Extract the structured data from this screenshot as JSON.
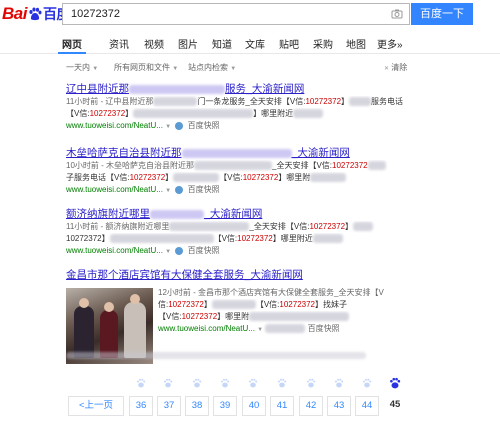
{
  "logo": {
    "part1": "Bai",
    "part2": "百度"
  },
  "search": {
    "value": "10272372",
    "button_label": "百度一下"
  },
  "tabs": [
    {
      "label": "网页"
    },
    {
      "label": "资讯"
    },
    {
      "label": "视频"
    },
    {
      "label": "图片"
    },
    {
      "label": "知道"
    },
    {
      "label": "文库"
    },
    {
      "label": "贴吧"
    },
    {
      "label": "采购"
    },
    {
      "label": "地图"
    },
    {
      "label": "更多»"
    }
  ],
  "filters": {
    "time": "一天内",
    "type": "所有网页和文件",
    "site": "站点内检索",
    "clear": "清除"
  },
  "results": [
    {
      "title_a": "辽中县附近那",
      "title_b": "服务_大渝新闻网",
      "line1_a": "11小时前 - 辽中县附近那",
      "line1_b": "门一条龙服务_全天安排【V信:",
      "line1_red": "10272372",
      "line1_c": "】",
      "line1_d": "服务电话",
      "line2_a": "【V信:",
      "line2_red": "10272372",
      "line2_b": "】",
      "line2_c": "】哪里附近",
      "line2_red2": "10272372",
      "line2_d": "】",
      "url": "www.tuoweisi.com/NeatU...",
      "snapshot": "百度快照"
    },
    {
      "title_a": "木垒哈萨克自治县附近那",
      "title_b": "_大渝新闻网",
      "line1_a": "10小时前 - 木垒哈萨克自治县附近那",
      "line1_b": "_全天安排【V信:",
      "line1_red": "10272372",
      "line1_c": "",
      "line1_d": "",
      "line2_a": "子服务电话【V信:",
      "line2_red": "10272372",
      "line2_b": "】",
      "line2_c": "【V信:",
      "line2_red2": "10272372",
      "line2_d": "】哪里附",
      "url": "www.tuoweisi.com/NeatU...",
      "snapshot": "百度快照"
    },
    {
      "title_a": "额济纳旗附近哪里",
      "title_b": "_大渝新闻网",
      "line1_a": "11小时前 - 额济纳旗附近哪里",
      "line1_b": "_全天安排【V信:",
      "line1_red": "10272372",
      "line1_c": "】",
      "line1_d": "",
      "line2_a": "10272372】",
      "line2_red": "",
      "line2_b": "",
      "line2_c": "【V信:",
      "line2_red2": "10272372",
      "line2_d": "】哪里附近",
      "url": "www.tuoweisi.com/NeatU...",
      "snapshot": "百度快照"
    },
    {
      "title": "金昌市那个酒店宾馆有大保健全套服务_大渝新闻网",
      "line1_a": "12小时前 - 金昌市那个酒店宾馆有大保健全套服务_全天安排【V",
      "line2_a": "信:",
      "line2_red": "10272372",
      "line2_b": "】",
      "line2_c": "【V信:",
      "line2_red2": "10272372",
      "line2_d": "】找妹子",
      "line3_a": "【V信:",
      "line3_red": "10272372",
      "line3_b": "】哪里附",
      "url": "www.tuoweisi.com/NeatU...",
      "snapshot": "百度快照"
    }
  ],
  "pagination": {
    "prev": "<上一页",
    "pages": [
      "36",
      "37",
      "38",
      "39",
      "40",
      "41",
      "42",
      "43",
      "44"
    ],
    "current": "45"
  },
  "colors": {
    "link": "#2b21c9",
    "accent": "#3385ff",
    "url_green": "#008000",
    "highlight_red": "#c00000"
  }
}
